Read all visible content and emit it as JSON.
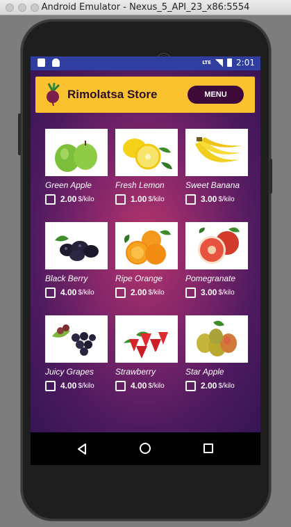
{
  "window": {
    "title": "Android Emulator - Nexus_5_API_23_x86:5554"
  },
  "statusbar": {
    "network": "LTE",
    "time": "2:01"
  },
  "header": {
    "title": "Rimolatsa Store",
    "menu_label": "MENU",
    "logo_icon": "beet-icon"
  },
  "colors": {
    "header_bg": "#fbc22f",
    "menu_bg": "#3d0a3a",
    "statusbar_bg": "#303f9f"
  },
  "products": [
    {
      "name": "Green Apple",
      "price": "2.00",
      "unit": "$/kilo",
      "image": "green-apple-image",
      "checked": false
    },
    {
      "name": "Fresh Lemon",
      "price": "1.00",
      "unit": "$/kilo",
      "image": "lemon-image",
      "checked": false
    },
    {
      "name": "Sweet Banana",
      "price": "3.00",
      "unit": "$/kilo",
      "image": "banana-image",
      "checked": false
    },
    {
      "name": "Black Berry",
      "price": "4.00",
      "unit": "$/kilo",
      "image": "blackberry-image",
      "checked": false
    },
    {
      "name": "Ripe Orange",
      "price": "2.00",
      "unit": "$/kilo",
      "image": "orange-image",
      "checked": false
    },
    {
      "name": "Pomegranate",
      "price": "3.00",
      "unit": "$/kilo",
      "image": "pomegranate-image",
      "checked": false
    },
    {
      "name": "Juicy Grapes",
      "price": "4.00",
      "unit": "$/kilo",
      "image": "grapes-image",
      "checked": false
    },
    {
      "name": "Strawberry",
      "price": "4.00",
      "unit": "$/kilo",
      "image": "strawberry-image",
      "checked": false
    },
    {
      "name": "Star Apple",
      "price": "2.00",
      "unit": "$/kilo",
      "image": "star-apple-image",
      "checked": false
    }
  ]
}
